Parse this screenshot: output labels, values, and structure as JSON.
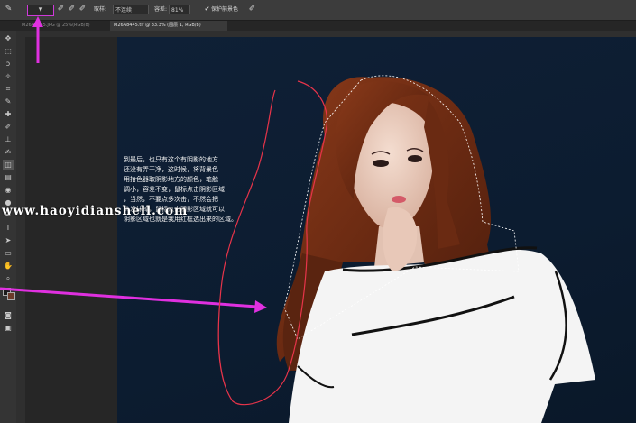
{
  "options_bar": {
    "tolerance_label": "容差:",
    "tolerance_value": "81%",
    "sample_mode_value": "不连续",
    "sample_label": "取样:",
    "protect_label": "保护前景色"
  },
  "tabs": [
    {
      "label": "M26A8445.JPG @ 25%(RGB/8)"
    },
    {
      "label": "M26A8445.tif @ 33.3% (图层 1, RGB/8)"
    }
  ],
  "tutorial": {
    "lines": [
      "到最后，也只有这个有阴影的地方",
      "还没有弄干净，这时候，将背景色",
      "用拾色器取阴影地方的颜色，笔触",
      "调小，容差不变，鼠标点击阴影区域",
      "，当然，不要点多次击，不然会把",
      "头发抹掉，鼠标点击阴影区域就可以",
      "阴影区域也就是我用红框选出来的区域。"
    ]
  },
  "watermark": "www.haoyidianshell.com",
  "colors": {
    "annotation_arrow": "#e030e0",
    "annotation_outline": "#e8344a",
    "canvas_bg": "#0d1d31"
  },
  "icons": [
    "brush-tool-icon",
    "eraser-icon",
    "lasso-icon",
    "move-tool-icon",
    "hand-tool-icon",
    "zoom-tool-icon",
    "foreground-color-swatch"
  ]
}
